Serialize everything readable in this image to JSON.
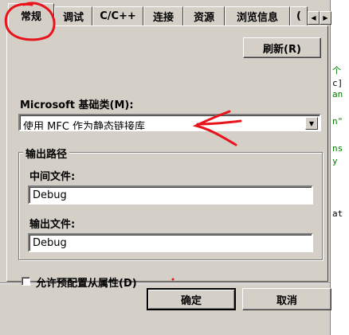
{
  "tabs": [
    {
      "label": "常规"
    },
    {
      "label": "调试"
    },
    {
      "label": "C/C++"
    },
    {
      "label": "连接"
    },
    {
      "label": "资源"
    },
    {
      "label": "浏览信息"
    },
    {
      "label": "("
    }
  ],
  "tab_scroll": {
    "left_glyph": "◀",
    "right_glyph": "▶"
  },
  "refresh_button": {
    "label": "刷新(R)"
  },
  "mfc": {
    "label": "Microsoft 基础类(M):",
    "value": "使用 MFC 作为静态链接库"
  },
  "output_group": {
    "title": "输出路径",
    "intermediate_label": "中间文件:",
    "intermediate_value": "Debug",
    "output_label": "输出文件:",
    "output_value": "Debug"
  },
  "allow_config": {
    "label": "允许预配置从属性(D)",
    "checked": false
  },
  "footer": {
    "ok_label": "确定",
    "cancel_label": "取消"
  },
  "background_code": [
    "个",
    "c]",
    "an",
    "n\"",
    "ns",
    "y",
    "at"
  ],
  "colors": {
    "annotation_red": "#e8141c",
    "dialog_face": "#d4d0c8"
  }
}
